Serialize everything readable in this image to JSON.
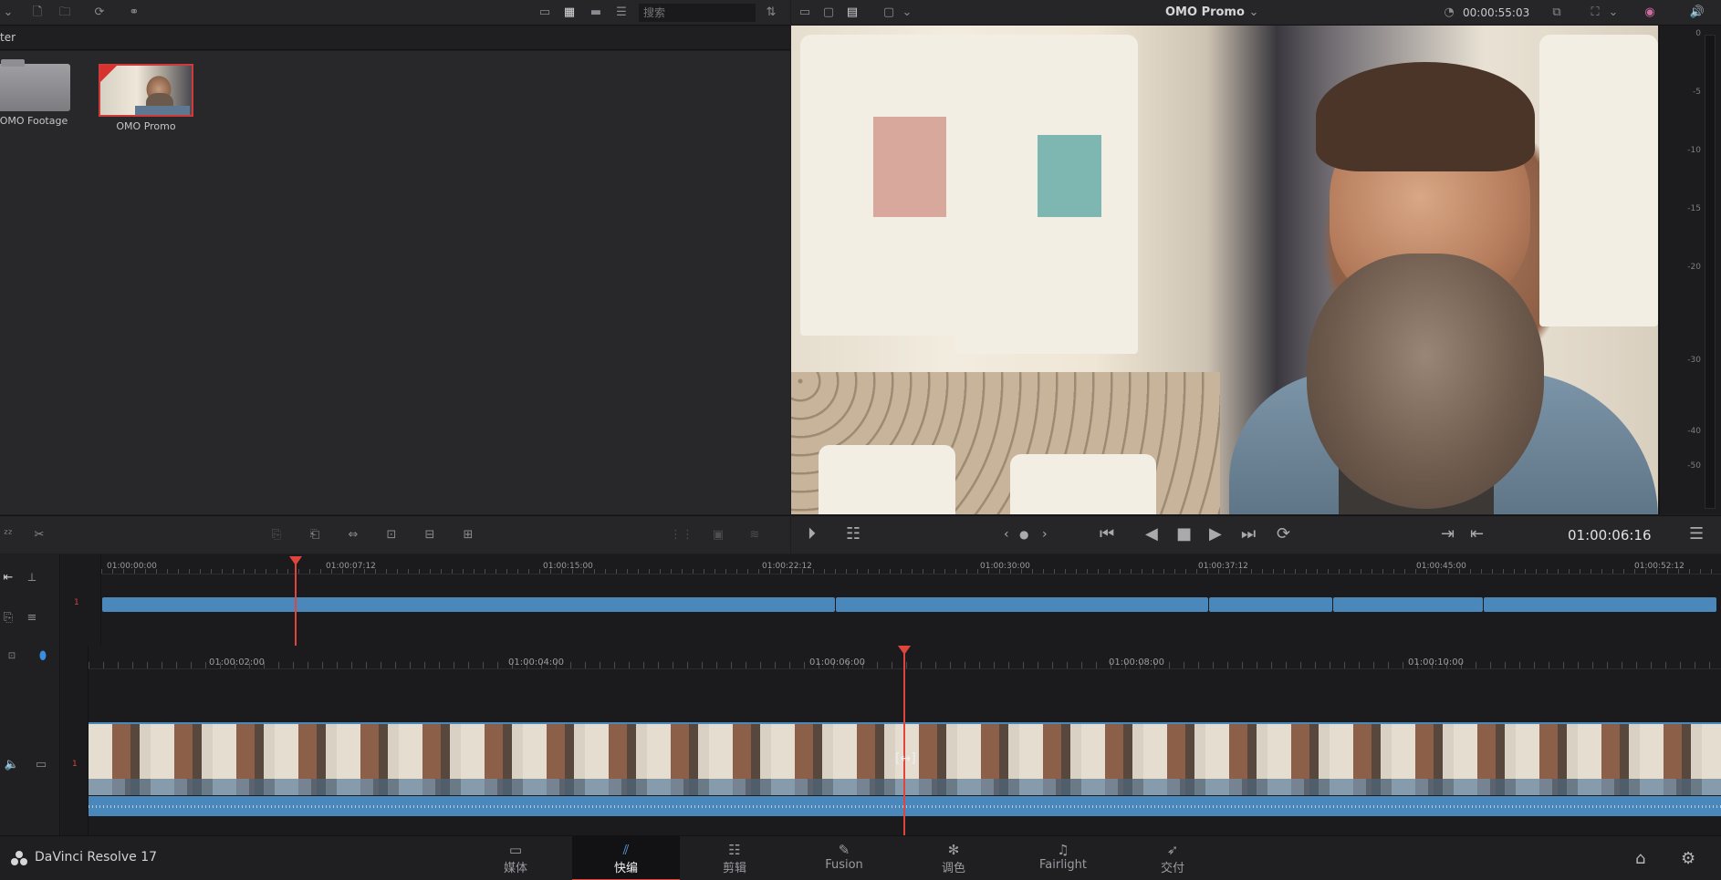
{
  "media_pool": {
    "search_placeholder": "搜索",
    "path_label": "ter",
    "items": [
      {
        "label": "OMO Footage",
        "kind": "folder"
      },
      {
        "label": "OMO Promo",
        "kind": "timeline"
      }
    ]
  },
  "viewer": {
    "timeline_name": "OMO Promo",
    "duration": "00:00:55:03",
    "timecode": "01:00:06:16"
  },
  "meter": {
    "ticks": [
      "0",
      "-5",
      "-10",
      "-15",
      "-20",
      "-30",
      "-40",
      "-50"
    ]
  },
  "strip": {
    "track": "1",
    "timecodes": [
      "01:00:00:00",
      "01:00:07:12",
      "01:00:15:00",
      "01:00:22:12",
      "01:00:30:00",
      "01:00:37:12",
      "01:00:45:00",
      "01:00:52:12"
    ]
  },
  "timeline": {
    "track": "1",
    "timecodes": [
      "01:00:02:00",
      "01:00:04:00",
      "01:00:06:00",
      "01:00:08:00",
      "01:00:10:00"
    ]
  },
  "pagebar": {
    "app_name": "DaVinci Resolve 17",
    "tabs": [
      {
        "label": "媒体",
        "icon": "media-page-icon"
      },
      {
        "label": "快编",
        "icon": "cut-page-icon"
      },
      {
        "label": "剪辑",
        "icon": "edit-page-icon"
      },
      {
        "label": "Fusion",
        "icon": "fusion-page-icon"
      },
      {
        "label": "调色",
        "icon": "color-page-icon"
      },
      {
        "label": "Fairlight",
        "icon": "fairlight-page-icon"
      },
      {
        "label": "交付",
        "icon": "deliver-page-icon"
      }
    ],
    "active_tab": "快编"
  },
  "colors": {
    "accent_red": "#e0453d",
    "clip_blue": "#4a87bb",
    "active_icon_blue": "#5ea1e0"
  }
}
